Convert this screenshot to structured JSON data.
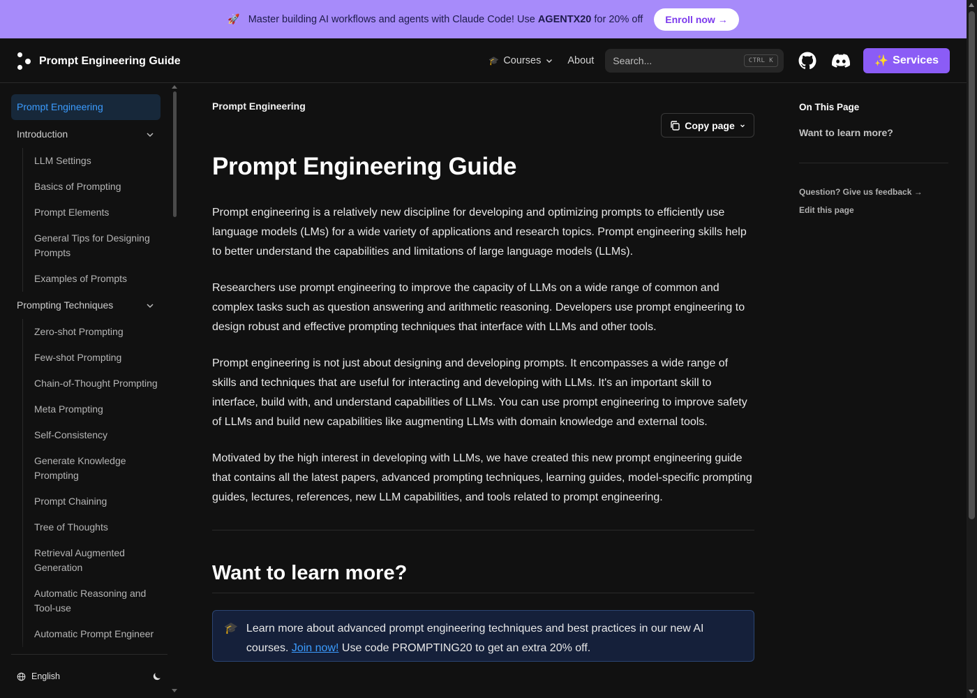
{
  "banner": {
    "rocket": "🚀",
    "text_before": "Master building AI workflows and agents with Claude Code! Use",
    "code": "AGENTX20",
    "text_after": "for 20% off",
    "enroll_label": "Enroll now →"
  },
  "navbar": {
    "logo_text": "Prompt Engineering Guide",
    "courses_icon": "🎓",
    "courses_label": "Courses",
    "about_label": "About",
    "search_placeholder": "Search...",
    "search_shortcut": "CTRL K",
    "services_icon": "✨",
    "services_label": "Services"
  },
  "sidebar": {
    "active": "Prompt Engineering",
    "sections": [
      {
        "label": "Introduction",
        "items": [
          "LLM Settings",
          "Basics of Prompting",
          "Prompt Elements",
          "General Tips for Designing Prompts",
          "Examples of Prompts"
        ]
      },
      {
        "label": "Prompting Techniques",
        "items": [
          "Zero-shot Prompting",
          "Few-shot Prompting",
          "Chain-of-Thought Prompting",
          "Meta Prompting",
          "Self-Consistency",
          "Generate Knowledge Prompting",
          "Prompt Chaining",
          "Tree of Thoughts",
          "Retrieval Augmented Generation",
          "Automatic Reasoning and Tool-use",
          "Automatic Prompt Engineer"
        ]
      }
    ],
    "language": "English"
  },
  "main": {
    "breadcrumb": "Prompt Engineering",
    "copy_label": "Copy page",
    "title": "Prompt Engineering Guide",
    "paragraphs": [
      "Prompt engineering is a relatively new discipline for developing and optimizing prompts to efficiently use language models (LMs) for a wide variety of applications and research topics. Prompt engineering skills help to better understand the capabilities and limitations of large language models (LLMs).",
      "Researchers use prompt engineering to improve the capacity of LLMs on a wide range of common and complex tasks such as question answering and arithmetic reasoning. Developers use prompt engineering to design robust and effective prompting techniques that interface with LLMs and other tools.",
      "Prompt engineering is not just about designing and developing prompts. It encompasses a wide range of skills and techniques that are useful for interacting and developing with LLMs. It's an important skill to interface, build with, and understand capabilities of LLMs. You can use prompt engineering to improve safety of LLMs and build new capabilities like augmenting LLMs with domain knowledge and external tools.",
      "Motivated by the high interest in developing with LLMs, we have created this new prompt engineering guide that contains all the latest papers, advanced prompting techniques, learning guides, model-specific prompting guides, lectures, references, new LLM capabilities, and tools related to prompt engineering."
    ],
    "section_title": "Want to learn more?",
    "callout": {
      "icon": "🎓",
      "text_before": "Learn more about advanced prompt engineering techniques and best practices in our new AI courses.",
      "link": "Join now!",
      "text_after": "Use code PROMPTING20 to get an extra 20% off."
    }
  },
  "toc": {
    "title": "On This Page",
    "link": "Want to learn more?",
    "feedback": "Question? Give us feedback →",
    "edit": "Edit this page"
  },
  "colors": {
    "banner_bg": "#a78bfa",
    "accent": "#8b5cf6",
    "link": "#3b9cff",
    "background": "#111111"
  }
}
